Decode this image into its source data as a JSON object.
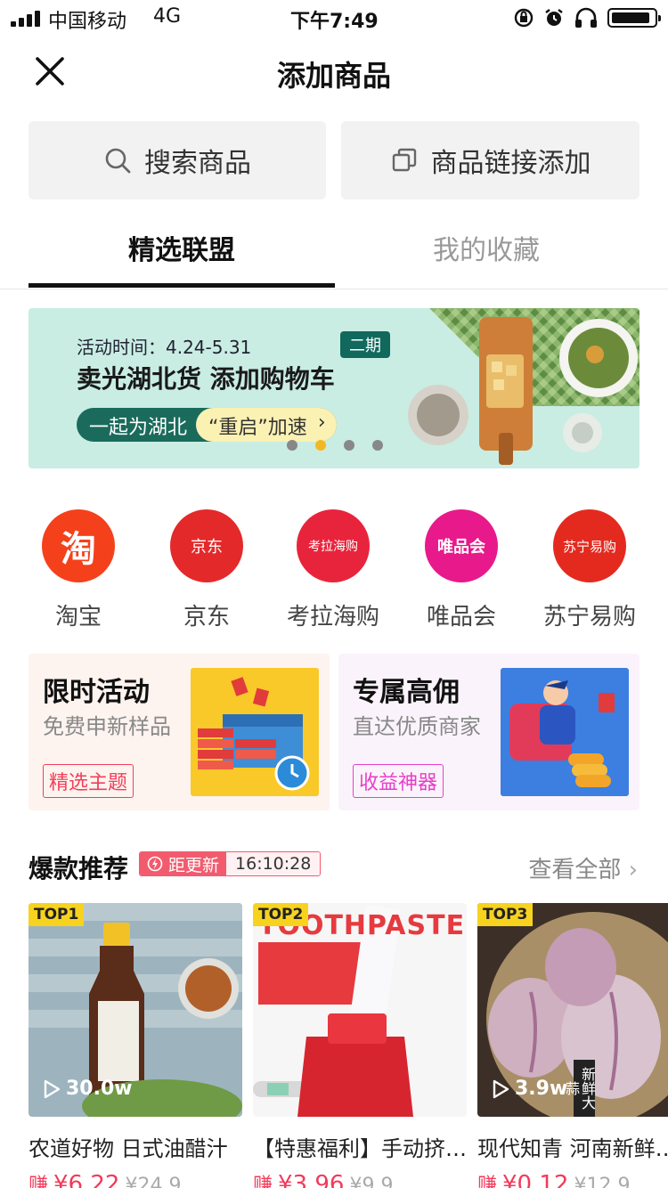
{
  "status_bar": {
    "carrier": "中国移动",
    "network": "4G",
    "time": "下午7:49"
  },
  "nav": {
    "title": "添加商品",
    "close_icon": "close-icon"
  },
  "actions": {
    "search_label": "搜索商品",
    "link_add_label": "商品链接添加"
  },
  "tabs": [
    {
      "label": "精选联盟",
      "active": true
    },
    {
      "label": "我的收藏",
      "active": false
    }
  ],
  "banner": {
    "date_text": "活动时间：4.24-5.31",
    "headline": "卖光湖北货 添加购物车",
    "badge": "二期",
    "cta_left": "一起为湖北",
    "cta_right": "“重启”加速",
    "slide_count": 4,
    "active_slide": 2
  },
  "platforms": [
    {
      "label": "淘宝",
      "logo_text": "淘",
      "color": "#f4411b"
    },
    {
      "label": "京东",
      "logo_text": "京东",
      "color": "#e4292a"
    },
    {
      "label": "考拉海购",
      "logo_text": "考拉海购",
      "color": "#e8243c"
    },
    {
      "label": "唯品会",
      "logo_text": "唯品会",
      "color": "#e8198b"
    },
    {
      "label": "苏宁易购",
      "logo_text": "苏宁易购",
      "color": "#e42a1f"
    }
  ],
  "promo_cards": [
    {
      "title": "限时活动",
      "subtitle": "免费申新样品",
      "tag": "精选主题",
      "tag_color": "#f0415a"
    },
    {
      "title": "专属高佣",
      "subtitle": "直达优质商家",
      "tag": "收益神器",
      "tag_color": "#e73fc9"
    }
  ],
  "hot": {
    "title": "爆款推荐",
    "countdown_label": "距更新",
    "countdown_time": "16:10:28",
    "view_all": "查看全部"
  },
  "products": [
    {
      "rank": "TOP1",
      "views": "30.0w",
      "name": "农道好物 日式油醋汁",
      "earn": "赚",
      "price": "¥6.22",
      "orig": "¥24.9"
    },
    {
      "rank": "TOP2",
      "views": "",
      "name": "【特惠福利】手动挤牙膏器",
      "earn": "赚",
      "price": "¥3.96",
      "orig": "¥9.9",
      "image_text": "TOOTHPASTE"
    },
    {
      "rank": "TOP3",
      "views": "3.9w",
      "name": "现代知青 河南新鲜大蒜",
      "earn": "赚",
      "price": "¥0.12",
      "orig": "¥12.9",
      "image_text": "新鲜大蒜"
    }
  ]
}
